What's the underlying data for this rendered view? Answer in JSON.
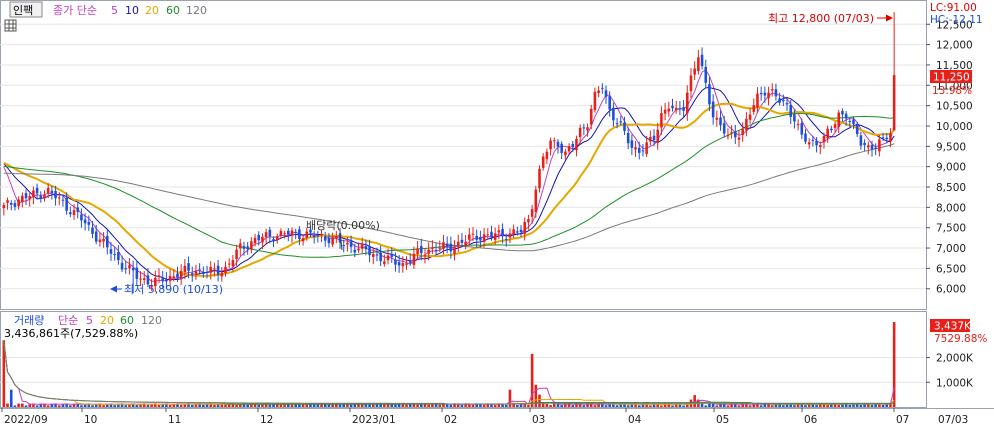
{
  "toolbar": {
    "mode_button": "인팩",
    "ma_title": "종가 단순",
    "ma_periods": [
      "5",
      "10",
      "20",
      "60",
      "120"
    ]
  },
  "price_panel": {
    "lc_label": "LC:91.00",
    "hc_label": "HC:-12.11",
    "current_price_tag": "11,250",
    "change_pct_tag": "13.98%",
    "high_annotation": "최고 12,800 (07/03)",
    "low_annotation": "최저 5,890 (10/13)",
    "dividend_annotation": "배당락(0.00%)",
    "y_ticks": [
      "12,500",
      "12,000",
      "11,500",
      "11,000",
      "10,500",
      "10,000",
      "9,500",
      "9,000",
      "8,500",
      "8,000",
      "7,500",
      "7,000",
      "6,500",
      "6,000"
    ]
  },
  "volume_panel": {
    "title_vol": "거래량",
    "ma_title": "단순",
    "ma_periods": [
      "5",
      "20",
      "60",
      "120"
    ],
    "info": "3,436,861주(7,529.88%)",
    "current_tag": "3,437K",
    "pct_tag": "7529.88%",
    "y_ticks": [
      "2,000K",
      "1,000K"
    ]
  },
  "x_axis": {
    "labels": [
      "2022/09",
      "10",
      "11",
      "12",
      "2023/01",
      "02",
      "03",
      "04",
      "05",
      "06",
      "07",
      "07/03"
    ]
  },
  "colors": {
    "up": "#e8201a",
    "down": "#1d4fd8",
    "ma5": "#c040c0",
    "ma10": "#1414b4",
    "ma20": "#e6a800",
    "ma60": "#1f8f2a",
    "ma120": "#7a7a7a",
    "annot_red": "#e00000",
    "annot_blue": "#1d4fd8"
  },
  "chart_data": {
    "type": "candlestick",
    "series": [
      {
        "name": "MA5",
        "values": []
      },
      {
        "name": "MA10",
        "values": []
      },
      {
        "name": "MA20",
        "values": []
      },
      {
        "name": "MA60",
        "values": []
      },
      {
        "name": "MA120",
        "values": []
      }
    ],
    "keyframes_close": [
      [
        0,
        8000
      ],
      [
        4,
        8200
      ],
      [
        8,
        8300
      ],
      [
        12,
        8400
      ],
      [
        16,
        8100
      ],
      [
        20,
        7800
      ],
      [
        24,
        7400
      ],
      [
        28,
        7000
      ],
      [
        32,
        6600
      ],
      [
        36,
        6300
      ],
      [
        40,
        6150
      ],
      [
        44,
        6250
      ],
      [
        48,
        6400
      ],
      [
        52,
        6450
      ],
      [
        56,
        6400
      ],
      [
        60,
        6500
      ],
      [
        64,
        7000
      ],
      [
        68,
        7200
      ],
      [
        72,
        7300
      ],
      [
        76,
        7350
      ],
      [
        80,
        7350
      ],
      [
        84,
        7300
      ],
      [
        88,
        7250
      ],
      [
        92,
        7100
      ],
      [
        96,
        7000
      ],
      [
        100,
        6850
      ],
      [
        104,
        6700
      ],
      [
        108,
        6600
      ],
      [
        112,
        6850
      ],
      [
        116,
        7000
      ],
      [
        120,
        7000
      ],
      [
        124,
        7150
      ],
      [
        128,
        7300
      ],
      [
        132,
        7300
      ],
      [
        136,
        7350
      ],
      [
        140,
        7400
      ],
      [
        142,
        7700
      ],
      [
        144,
        8500
      ],
      [
        146,
        9200
      ],
      [
        148,
        9600
      ],
      [
        150,
        9600
      ],
      [
        152,
        9300
      ],
      [
        154,
        9500
      ],
      [
        156,
        9900
      ],
      [
        158,
        10100
      ],
      [
        160,
        10700
      ],
      [
        162,
        11000
      ],
      [
        164,
        10400
      ],
      [
        166,
        10100
      ],
      [
        168,
        9800
      ],
      [
        170,
        9500
      ],
      [
        172,
        9400
      ],
      [
        174,
        9500
      ],
      [
        176,
        9700
      ],
      [
        178,
        10300
      ],
      [
        180,
        10500
      ],
      [
        182,
        10300
      ],
      [
        184,
        10500
      ],
      [
        186,
        11200
      ],
      [
        188,
        11700
      ],
      [
        190,
        11000
      ],
      [
        192,
        10300
      ],
      [
        194,
        10000
      ],
      [
        196,
        9700
      ],
      [
        198,
        9800
      ],
      [
        200,
        9900
      ],
      [
        202,
        10300
      ],
      [
        204,
        10700
      ],
      [
        206,
        10900
      ],
      [
        208,
        10800
      ],
      [
        210,
        10600
      ],
      [
        212,
        10500
      ],
      [
        214,
        10200
      ],
      [
        216,
        9700
      ],
      [
        218,
        9600
      ],
      [
        220,
        9600
      ],
      [
        222,
        9700
      ],
      [
        224,
        9900
      ],
      [
        226,
        10300
      ],
      [
        228,
        10300
      ],
      [
        230,
        9900
      ],
      [
        232,
        9600
      ],
      [
        234,
        9500
      ],
      [
        236,
        9500
      ],
      [
        238,
        9600
      ],
      [
        240,
        9900
      ],
      [
        241,
        11250
      ]
    ],
    "ohlc_highlights": {
      "high": 12800,
      "high_date": "07/03",
      "low": 5890,
      "low_date": "10/13",
      "last_close": 11250,
      "last_change_pct": 13.98
    },
    "volume_highlights": {
      "last_volume": 3436861,
      "last_volume_k": "3,437K",
      "last_volume_pct": 7529.88
    },
    "y_range": [
      5600,
      12900
    ],
    "volume_range": [
      0,
      3600000
    ],
    "x_categories": [
      "2022/09",
      "10",
      "11",
      "12",
      "2023/01",
      "02",
      "03",
      "04",
      "05",
      "06",
      "07"
    ]
  }
}
